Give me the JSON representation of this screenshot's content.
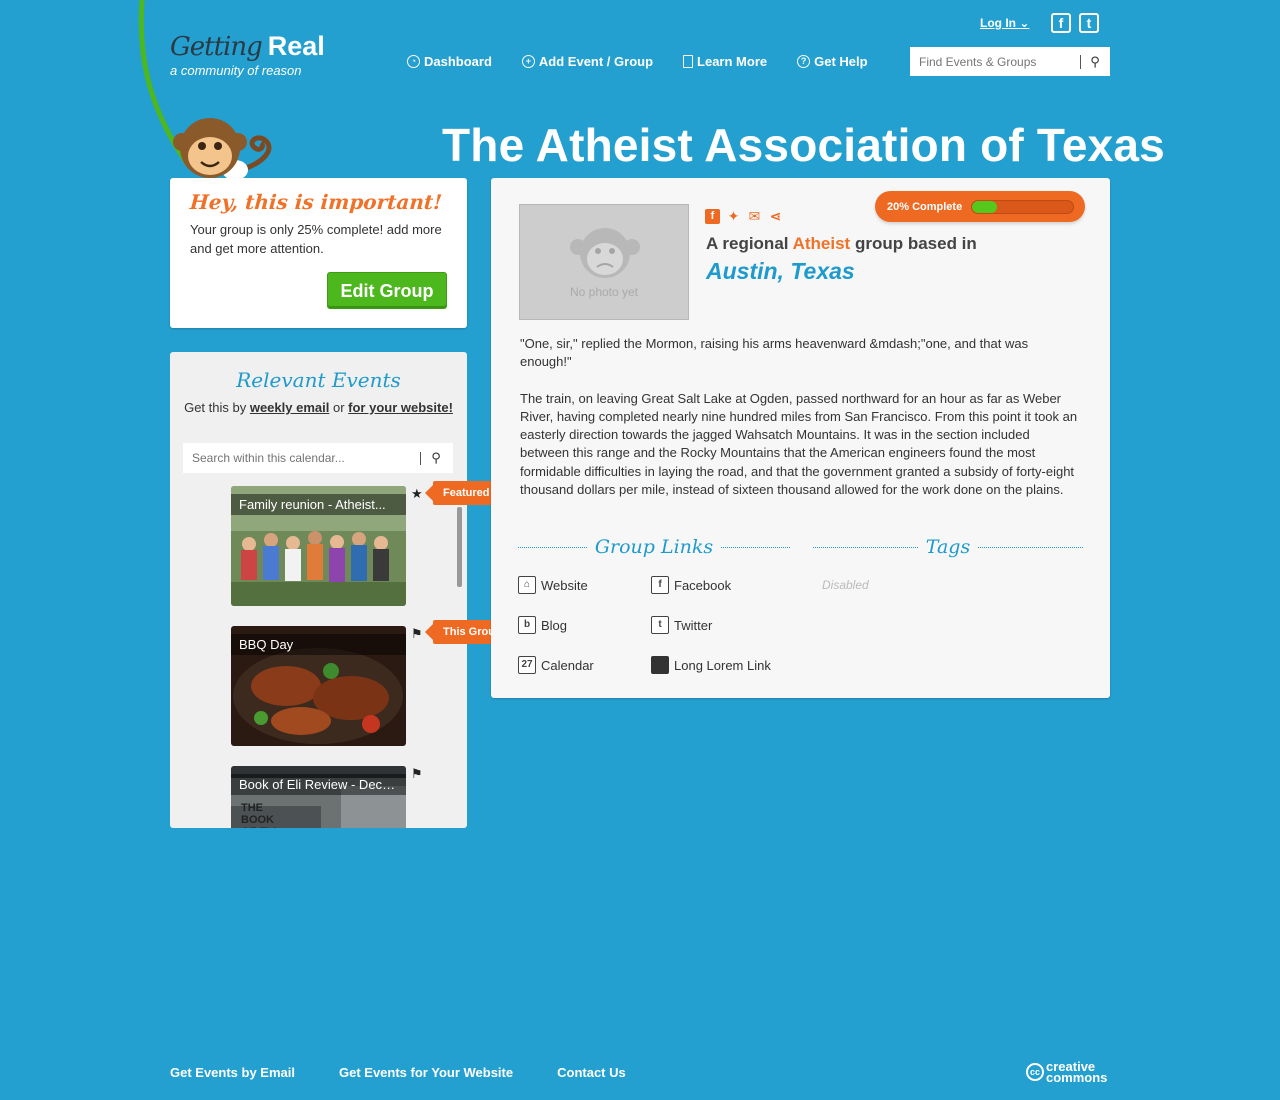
{
  "header": {
    "logo_line1_a": "Getting",
    "logo_line1_b": "Real",
    "logo_tagline": "a community of reason",
    "login_label": "Log In ⌄",
    "social": [
      {
        "icon": "facebook-icon",
        "glyph": "f"
      },
      {
        "icon": "twitter-icon",
        "glyph": "t"
      }
    ],
    "nav": [
      {
        "label": "Dashboard",
        "icon": "dashboard-icon"
      },
      {
        "label": "Add Event / Group",
        "icon": "add-icon"
      },
      {
        "label": "Learn More",
        "icon": "book-icon"
      },
      {
        "label": "Get Help",
        "icon": "help-icon"
      }
    ],
    "search_placeholder": "Find Events & Groups"
  },
  "page_title": "The Atheist Association of Texas",
  "important": {
    "heading": "Hey, this is important!",
    "text": "Your group is only 25% complete! add more and get more attention.",
    "button": "Edit Group"
  },
  "events": {
    "heading": "Relevant Events",
    "sub_prefix": "Get this by",
    "sub_link1": "weekly email",
    "sub_mid": "or",
    "sub_link2": "for your website!",
    "search_placeholder": "Search within this calendar...",
    "items": [
      {
        "title": "Family reunion - Atheist...",
        "badge": "Featured"
      },
      {
        "title": "BBQ Day",
        "badge": "This Group's Event"
      },
      {
        "title": "Book of Eli Review - Dece...",
        "image_text": "THE BOOK OF ELI"
      }
    ]
  },
  "group": {
    "photo_caption": "No photo yet",
    "share_icons": [
      "facebook-icon",
      "twitter-icon",
      "email-icon",
      "share-icon"
    ],
    "regional_prefix": "A regional",
    "regional_category": "Atheist",
    "regional_suffix": "group based in",
    "city": "Austin, Texas",
    "progress_label": "20% Complete",
    "progress_value": 0.25,
    "description": [
      "\"One, sir,\" replied the Mormon, raising his arms heavenward &mdash;\"one, and that was enough!\"",
      "The train, on leaving Great Salt Lake at Ogden, passed northward for an hour as far as Weber River, having completed nearly nine hundred miles from San Francisco.  From this point it took an easterly direction towards the jagged Wahsatch Mountains.  It was in the section included between this range and the Rocky Mountains that the American engineers found the most formidable difficulties in laying the road, and that the government granted a subsidy of forty-eight thousand dollars per mile, instead of sixteen thousand allowed for the work done on the plains."
    ],
    "links_heading": "Group Links",
    "links": [
      {
        "label": "Website",
        "icon": "home-icon"
      },
      {
        "label": "Facebook",
        "icon": "facebook-icon"
      },
      {
        "label": "Blog",
        "icon": "blog-icon"
      },
      {
        "label": "Twitter",
        "icon": "twitter-icon"
      },
      {
        "label": "Calendar",
        "icon": "calendar-icon"
      },
      {
        "label": "Long Lorem Link",
        "icon": "link-icon"
      }
    ],
    "tags_heading": "Tags",
    "tags_status": "Disabled"
  },
  "footer": {
    "links": [
      "Get Events by Email",
      "Get Events for Your Website",
      "Contact Us"
    ],
    "cc_line1": "creative",
    "cc_line2": "commons"
  },
  "colors": {
    "background": "#24a0d0",
    "accent": "#ee6a23",
    "link_blue": "#1e9bcc",
    "button_green": "#4cb81d"
  }
}
